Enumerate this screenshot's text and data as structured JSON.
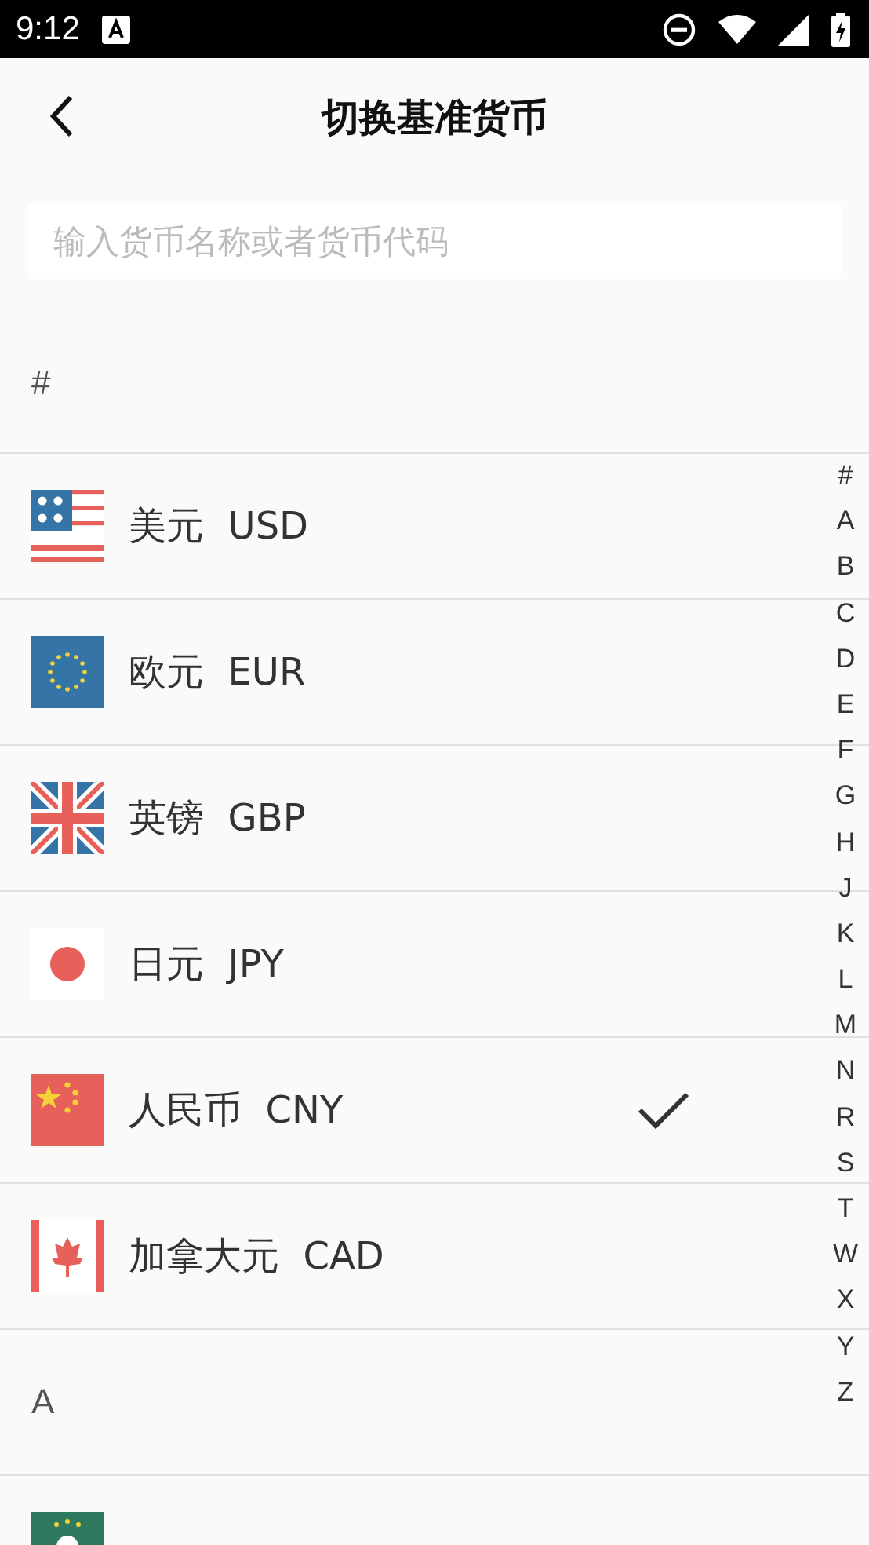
{
  "status_bar": {
    "time": "9:12"
  },
  "header": {
    "title": "切换基准货币"
  },
  "search": {
    "placeholder": "输入货币名称或者货币代码"
  },
  "list": [
    {
      "kind": "section",
      "label": "#"
    },
    {
      "kind": "currency",
      "flag": {
        "kind": "us"
      },
      "name": "美元",
      "code": "USD",
      "selected": false
    },
    {
      "kind": "currency",
      "flag": {
        "kind": "eu"
      },
      "name": "欧元",
      "code": "EUR",
      "selected": false
    },
    {
      "kind": "currency",
      "flag": {
        "kind": "gb"
      },
      "name": "英镑",
      "code": "GBP",
      "selected": false
    },
    {
      "kind": "currency",
      "flag": {
        "kind": "jp"
      },
      "name": "日元",
      "code": "JPY",
      "selected": false
    },
    {
      "kind": "currency",
      "flag": {
        "kind": "cn"
      },
      "name": "人民币",
      "code": "CNY",
      "selected": true
    },
    {
      "kind": "currency",
      "flag": {
        "kind": "ca"
      },
      "name": "加拿大元",
      "code": "CAD",
      "selected": false
    },
    {
      "kind": "section",
      "label": "A"
    },
    {
      "kind": "currency",
      "flag": {
        "kind": "mo"
      },
      "selected": false
    }
  ],
  "index": [
    "#",
    "A",
    "B",
    "C",
    "D",
    "E",
    "F",
    "G",
    "H",
    "J",
    "K",
    "L",
    "M",
    "N",
    "R",
    "S",
    "T",
    "W",
    "X",
    "Y",
    "Z"
  ]
}
